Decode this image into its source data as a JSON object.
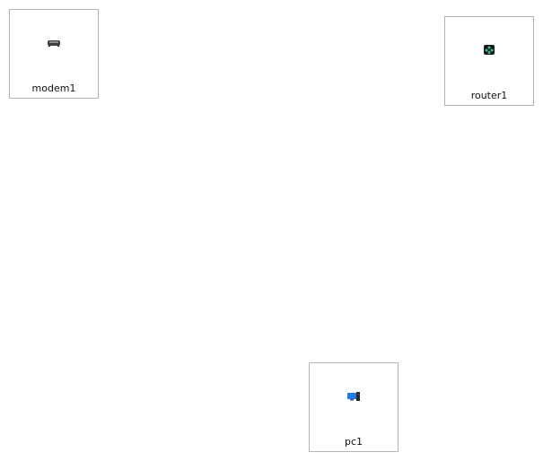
{
  "nodes": [
    {
      "id": "modem1",
      "label": "modem1",
      "icon": "modem-icon"
    },
    {
      "id": "router1",
      "label": "router1",
      "icon": "router-icon"
    },
    {
      "id": "pc1",
      "label": "pc1",
      "icon": "pc-icon"
    }
  ],
  "colors": {
    "border": "#b4b4b4",
    "router_accent": "#2ec4a0",
    "pc_screen": "#1e7cf0"
  }
}
